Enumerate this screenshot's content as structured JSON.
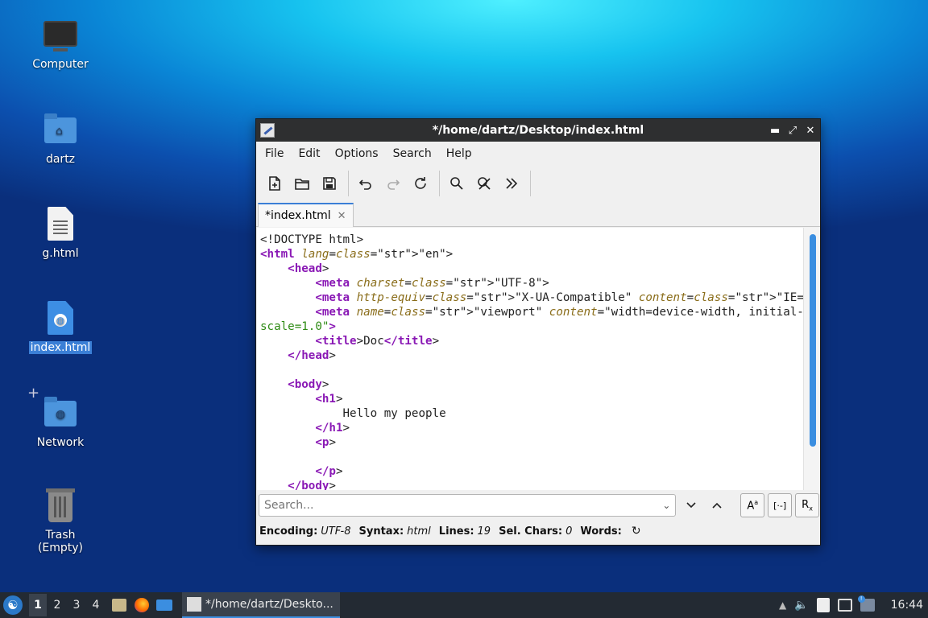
{
  "desktop": {
    "icons": [
      {
        "label": "Computer"
      },
      {
        "label": "dartz"
      },
      {
        "label": "g.html"
      },
      {
        "label": "index.html"
      },
      {
        "label": "Network"
      },
      {
        "label": "Trash (Empty)"
      }
    ]
  },
  "window": {
    "title": "*/home/dartz/Desktop/index.html",
    "menu": [
      "File",
      "Edit",
      "Options",
      "Search",
      "Help"
    ],
    "tab_label": "*index.html",
    "code_lines": [
      "<!DOCTYPE html>",
      "<html lang=\"en\">",
      "    <head>",
      "        <meta charset=\"UTF-8\">",
      "        <meta http-equiv=\"X-UA-Compatible\" content=\"IE=edge\">",
      "        <meta name=\"viewport\" content=\"width=device-width, initial-",
      "scale=1.0\">",
      "        <title>Doc</title>",
      "    </head>",
      "",
      "    <body>",
      "        <h1>",
      "            Hello my people",
      "        </h1>",
      "        <p>",
      "",
      "        </p>",
      "    </body>"
    ],
    "search_placeholder": "Search...",
    "status": {
      "encoding_label": "Encoding:",
      "encoding_value": "UTF-8",
      "syntax_label": "Syntax:",
      "syntax_value": "html",
      "lines_label": "Lines:",
      "lines_value": "19",
      "sel_label": "Sel. Chars:",
      "sel_value": "0",
      "words_label": "Words:"
    }
  },
  "taskbar": {
    "workspaces": [
      "1",
      "2",
      "3",
      "4"
    ],
    "task_title": "*/home/dartz/Deskto...",
    "clock": "16:44"
  }
}
